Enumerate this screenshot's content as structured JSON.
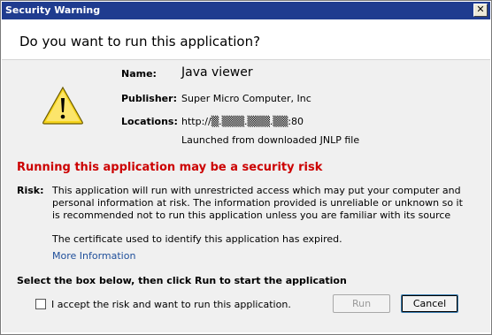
{
  "window": {
    "title": "Security Warning",
    "close_glyph": "✕"
  },
  "header": {
    "question": "Do you want to run this application?"
  },
  "details": {
    "name_label": "Name:",
    "name_value": "Java viewer",
    "publisher_label": "Publisher:",
    "publisher_value": "Super Micro Computer, Inc",
    "locations_label": "Locations:",
    "locations_value": "http://▒.▒▒▒.▒▒▒.▒▒:80",
    "launched_text": "Launched from downloaded JNLP file"
  },
  "risk": {
    "heading": "Running this application may be a security risk",
    "label": "Risk:",
    "description": "This application will run with unrestricted access which may put your computer and personal information at risk. The information provided is unreliable or unknown so it is recommended not to run this application unless you are familiar with its source",
    "certificate_text": "The certificate used to identify this application has expired.",
    "more_info_link": "More Information"
  },
  "footer": {
    "instruction": "Select the box below, then click Run to start the application",
    "checkbox_label": "I accept the risk and want to run this application.",
    "run_button": "Run",
    "cancel_button": "Cancel"
  },
  "icons": {
    "warning": "warning-triangle-icon"
  },
  "colors": {
    "titlebar": "#1f3c8f",
    "risk_heading": "#cc0000",
    "link": "#1e4e9a",
    "icon_yellow": "#f7d51d"
  }
}
